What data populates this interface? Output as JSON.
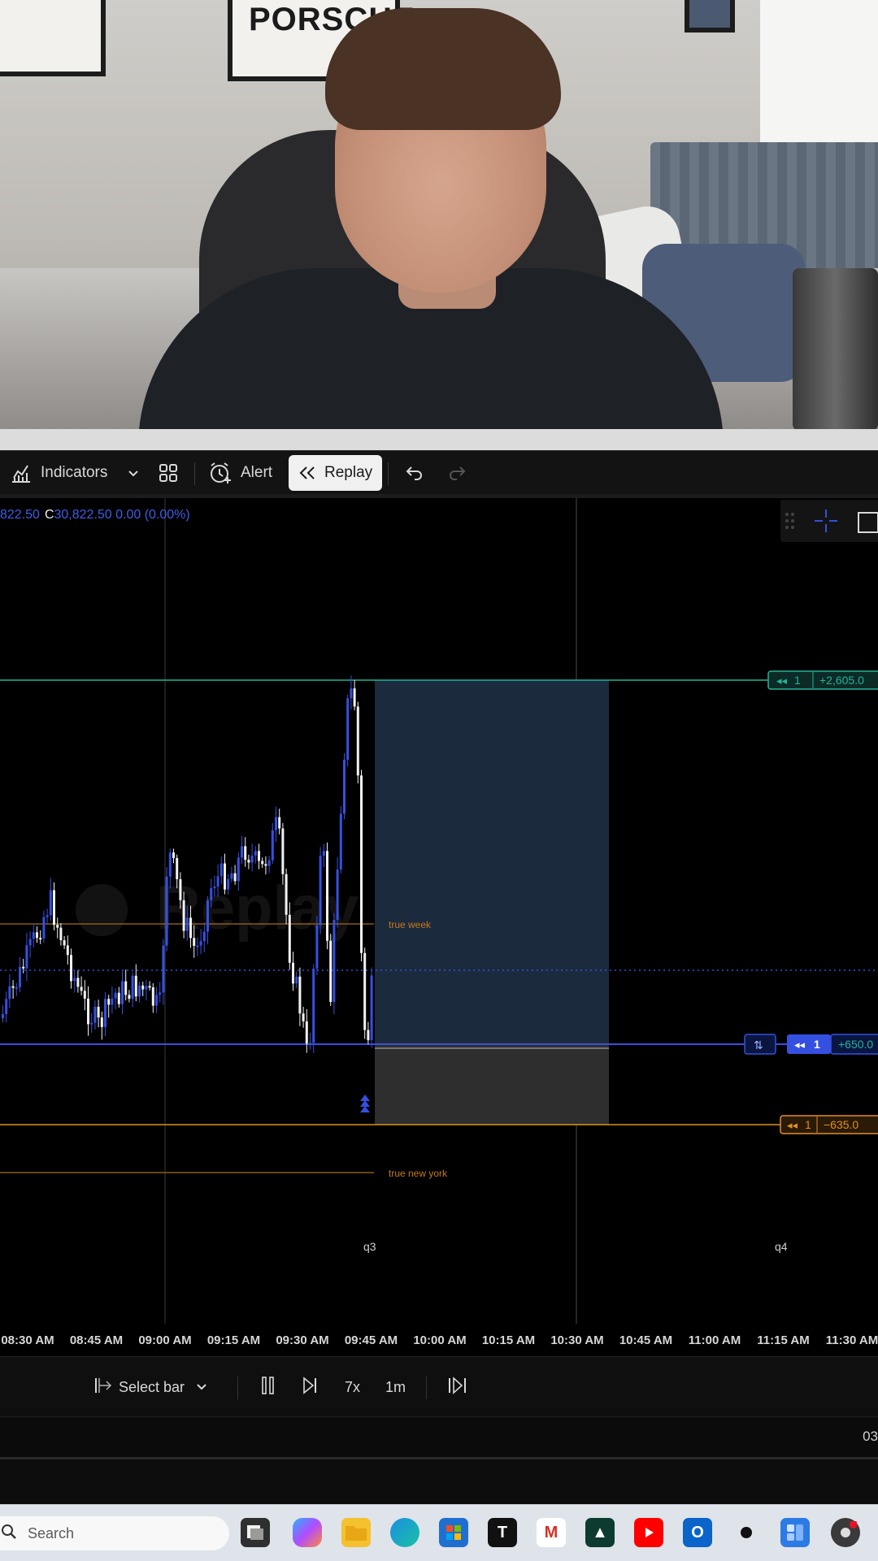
{
  "webcam": {
    "frame_text": "PORSCHE"
  },
  "toolbar": {
    "indicators_label": "Indicators",
    "alert_label": "Alert",
    "replay_label": "Replay"
  },
  "chart": {
    "ohlc_prefix": "822.50",
    "ohlc_close_letter": "C",
    "ohlc_close_value": "30,822.50 0.00 (0.00%)",
    "labels": {
      "true_week": "true week",
      "true_new_york": "true new york",
      "q3": "q3",
      "q4": "q4",
      "replay_watermark": "Replay"
    },
    "orders": {
      "take_profit": {
        "qty": "1",
        "value": "+2,605.0"
      },
      "entry": {
        "qty": "1",
        "value": "+650.0",
        "side_badge": "⇅"
      },
      "stop_loss": {
        "qty": "1",
        "value": "−635.0"
      }
    },
    "colors": {
      "bull": "#3550e0",
      "bear": "#f2f2f2",
      "take_profit_line": "#21b49a",
      "entry_line": "#3550e0",
      "stop_line": "#e08f23",
      "reward_zone": "#1c2a3d",
      "risk_zone": "#2e2e2e"
    }
  },
  "time_axis": [
    "08:30 AM",
    "08:45 AM",
    "09:00 AM",
    "09:15 AM",
    "09:30 AM",
    "09:45 AM",
    "10:00 AM",
    "10:15 AM",
    "10:30 AM",
    "10:45 AM",
    "11:00 AM",
    "11:15 AM",
    "11:30 AM"
  ],
  "replay_controls": {
    "select_bar_label": "Select bar",
    "speed_label": "7x",
    "interval_label": "1m"
  },
  "status": {
    "date_partial": "03"
  },
  "taskbar": {
    "search_placeholder": "Search",
    "apps": [
      "file-explorer",
      "copilot",
      "folder",
      "edge",
      "store",
      "typora",
      "gmail",
      "affinity",
      "youtube",
      "outlook",
      "obs",
      "widgets",
      "chrome"
    ]
  }
}
